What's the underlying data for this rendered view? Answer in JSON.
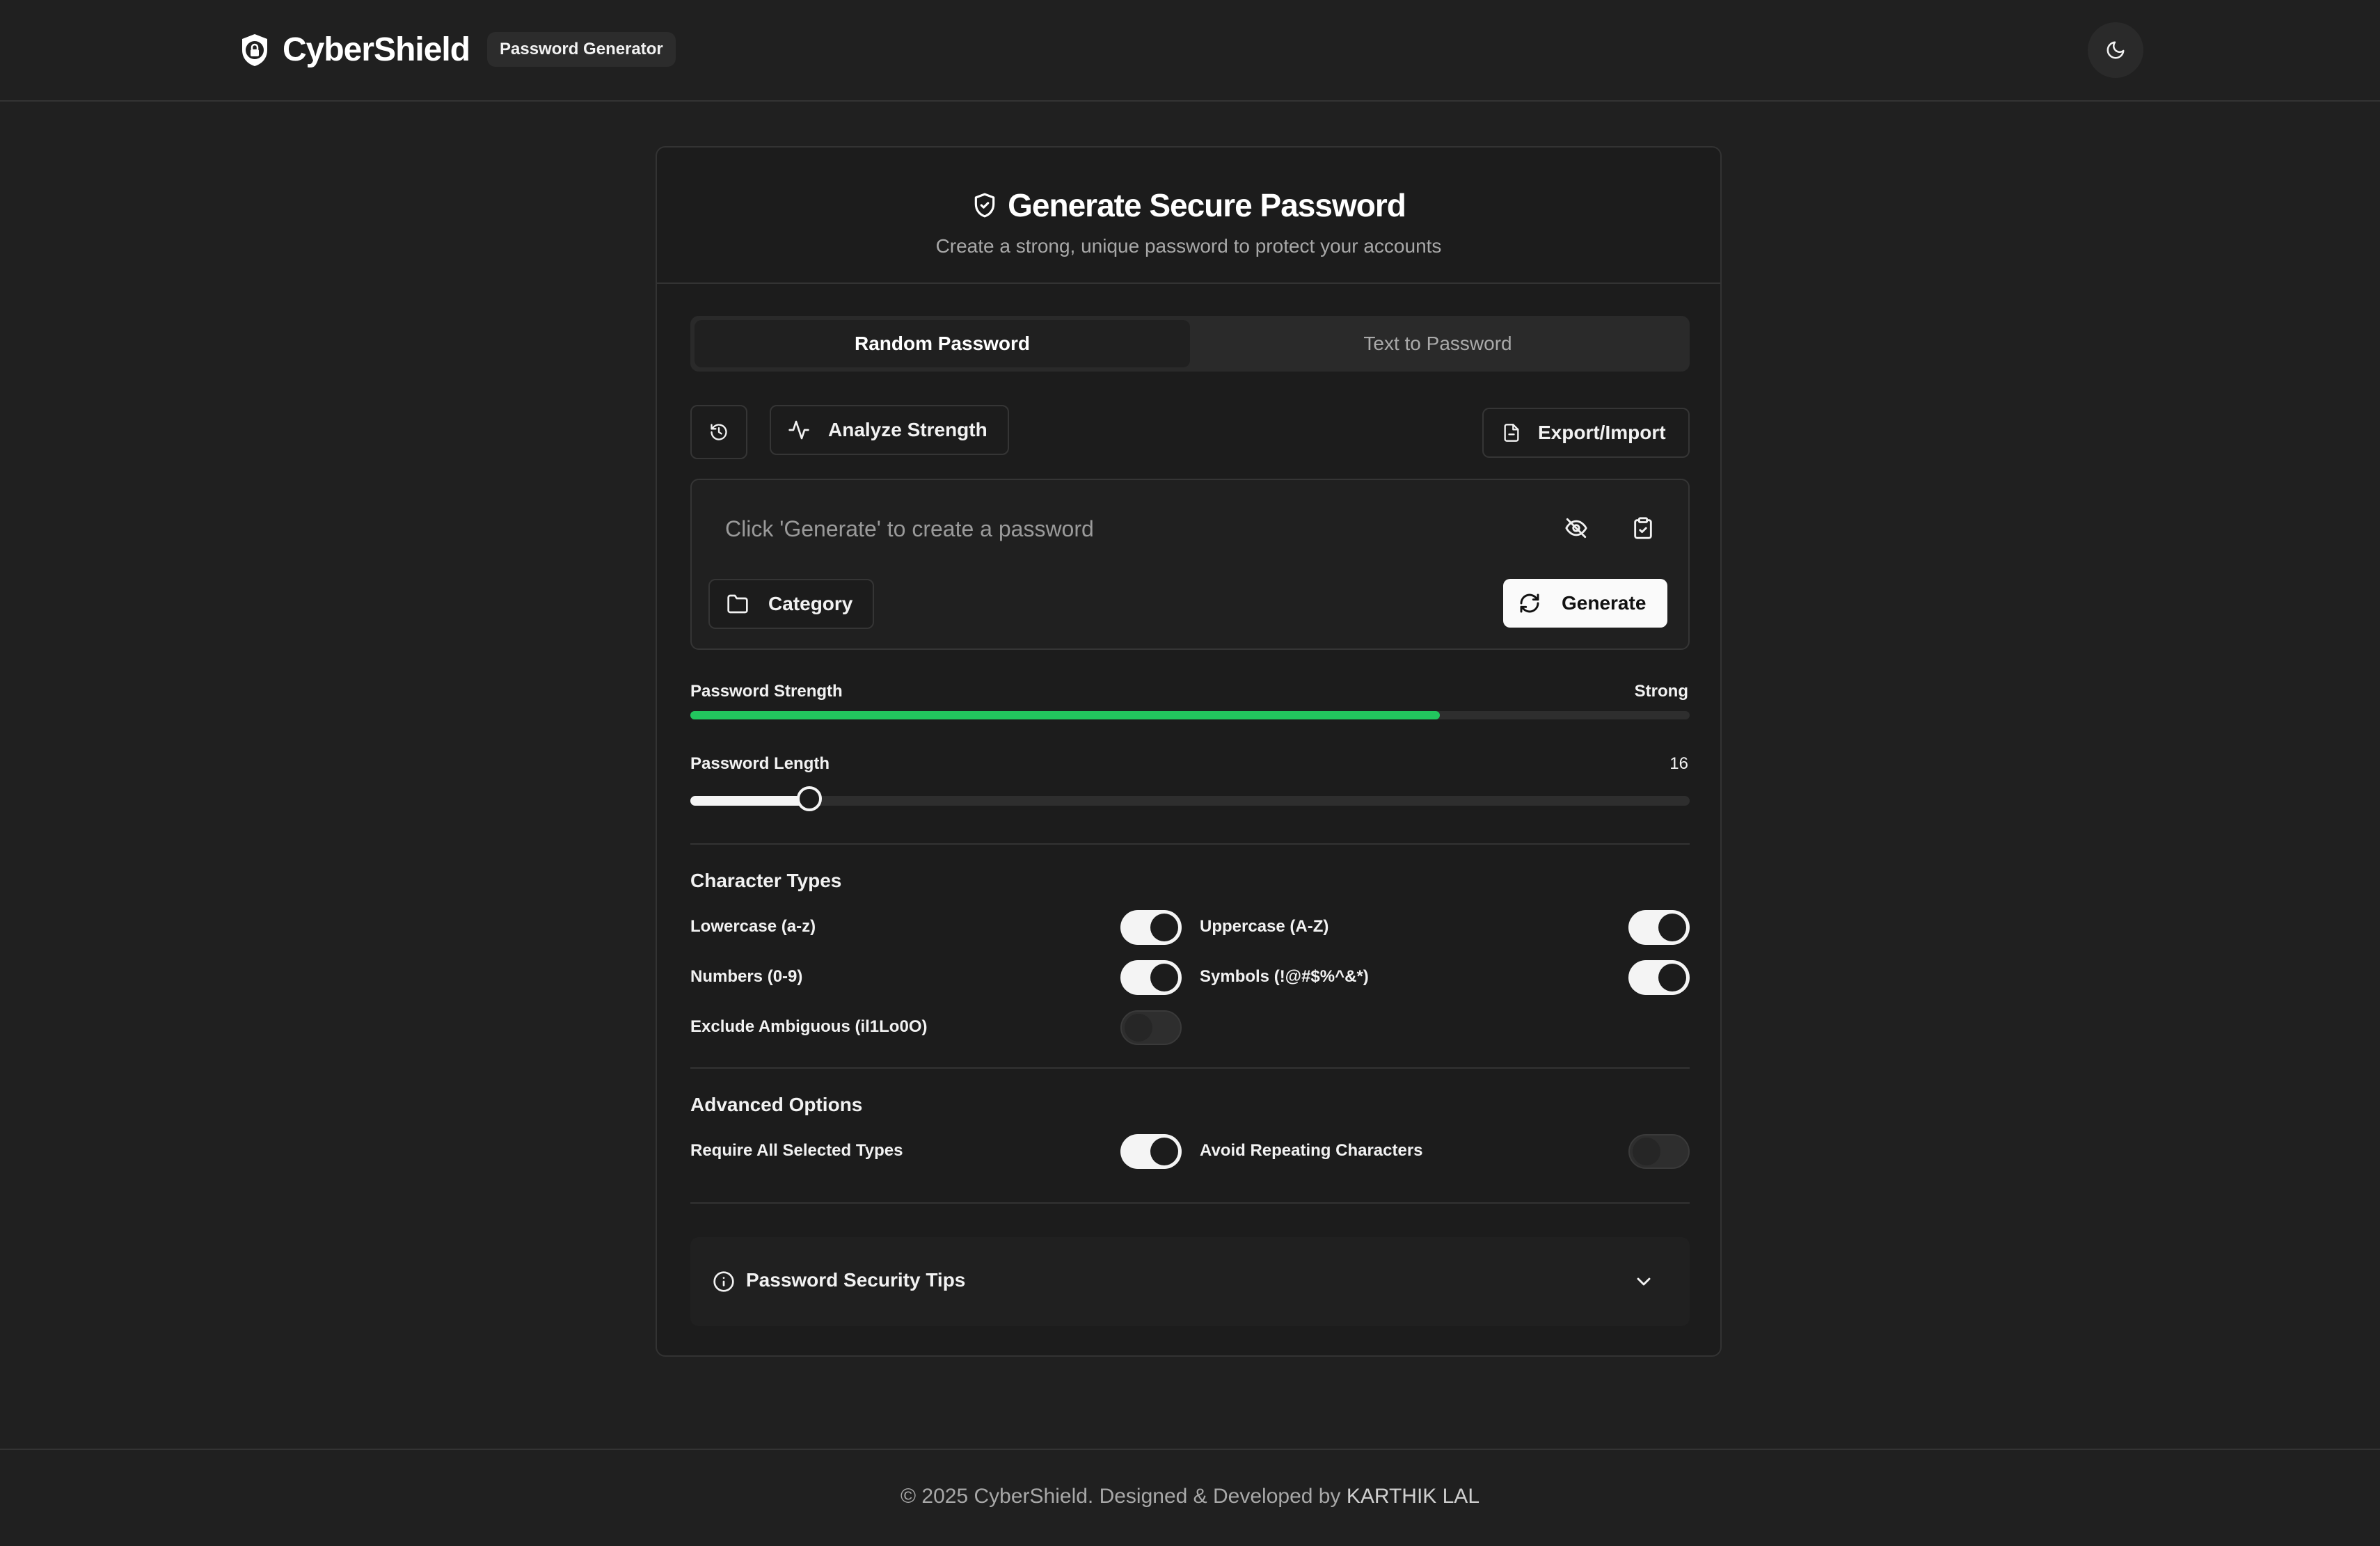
{
  "header": {
    "brand": "CyberShield",
    "badge": "Password Generator",
    "theme_icon": "moon-icon"
  },
  "card": {
    "title": "Generate Secure Password",
    "subtitle": "Create a strong, unique password to protect your accounts",
    "tabs": [
      {
        "label": "Random Password",
        "active": true
      },
      {
        "label": "Text to Password",
        "active": false
      }
    ],
    "toolbar": {
      "history_icon": "history-icon",
      "analyze_label": "Analyze Strength",
      "export_label": "Export/Import"
    },
    "password": {
      "placeholder": "Click 'Generate' to create a password",
      "category_label": "Category",
      "generate_label": "Generate"
    },
    "strength": {
      "label": "Password Strength",
      "value": "Strong",
      "percent": 75,
      "color": "#22c55e"
    },
    "length": {
      "label": "Password Length",
      "value": "16",
      "min": 8,
      "max": 128
    },
    "character_types": {
      "title": "Character Types",
      "options": [
        {
          "label": "Lowercase (a-z)",
          "on": true
        },
        {
          "label": "Uppercase (A-Z)",
          "on": true
        },
        {
          "label": "Numbers (0-9)",
          "on": true
        },
        {
          "label": "Symbols (!@#$%^&*)",
          "on": true
        },
        {
          "label": "Exclude Ambiguous (il1Lo0O)",
          "on": false
        }
      ]
    },
    "advanced": {
      "title": "Advanced Options",
      "options": [
        {
          "label": "Require All Selected Types",
          "on": true
        },
        {
          "label": "Avoid Repeating Characters",
          "on": false
        }
      ]
    },
    "tips": {
      "label": "Password Security Tips"
    }
  },
  "footer": {
    "text": "© 2025 CyberShield. Designed & Developed by ",
    "author": "KARTHIK LAL"
  },
  "colors": {
    "background": "#202020",
    "card": "#1c1c1c",
    "accent_green": "#22c55e"
  }
}
